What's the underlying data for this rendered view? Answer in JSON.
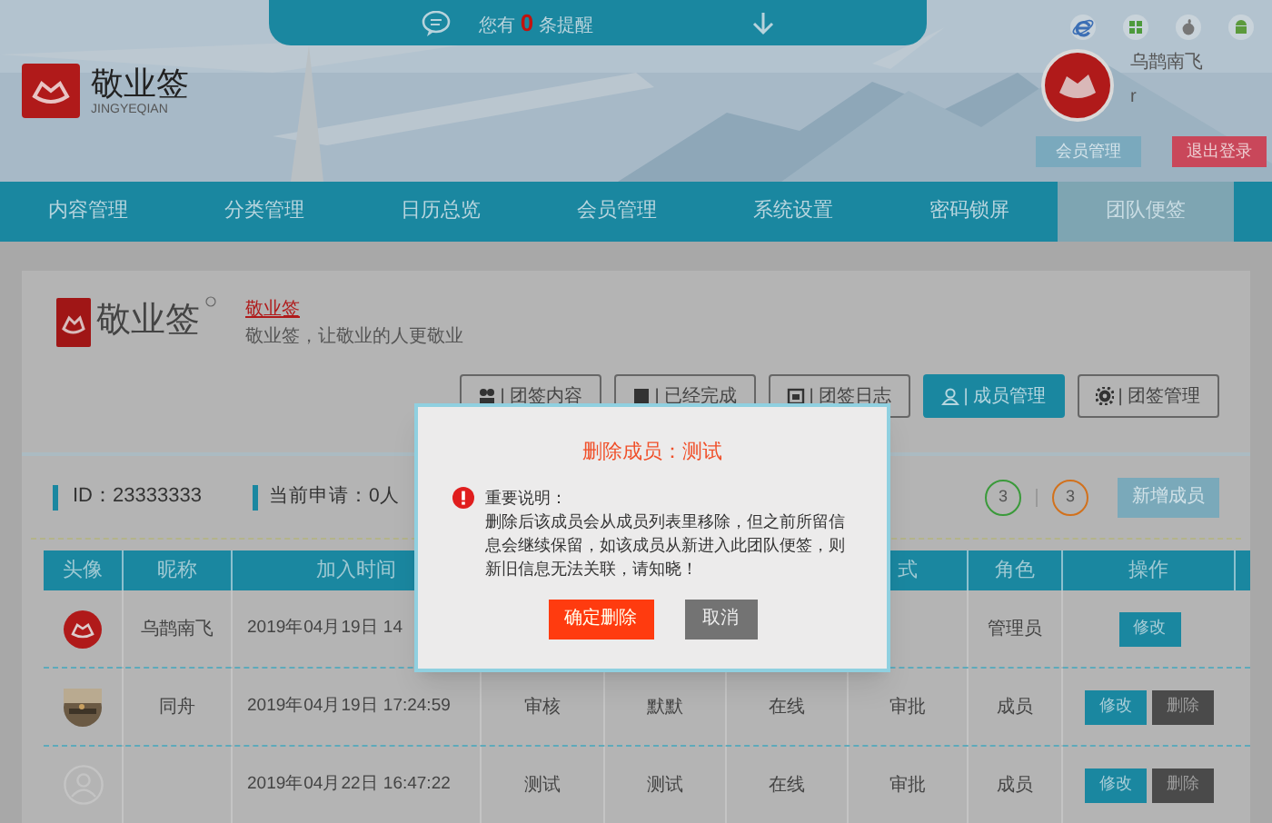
{
  "notice": {
    "prefix": "您有",
    "count": "0",
    "suffix": "条提醒"
  },
  "brand": {
    "name": "敬业签",
    "subtitle": "JINGYEQIAN"
  },
  "user": {
    "name": "乌鹊南飞",
    "account": "r",
    "buttons": [
      {
        "label": "会员管理",
        "kind": "primary"
      },
      {
        "label": "退出登录",
        "kind": "danger"
      }
    ]
  },
  "nav": [
    {
      "label": "内容管理",
      "selected": false
    },
    {
      "label": "分类管理",
      "selected": false
    },
    {
      "label": "日历总览",
      "selected": false
    },
    {
      "label": "会员管理",
      "selected": false
    },
    {
      "label": "系统设置",
      "selected": false
    },
    {
      "label": "密码锁屏",
      "selected": false
    },
    {
      "label": "团队便签",
      "selected": true
    }
  ],
  "team": {
    "logo_text": "敬业签",
    "name": "敬业签",
    "tagline": "敬业签，让敬业的人更敬业"
  },
  "tabs": [
    {
      "label": "| 团签内容",
      "kind": "people",
      "selected": false
    },
    {
      "label": "| 已经完成",
      "kind": "book",
      "selected": false
    },
    {
      "label": "| 团签日志",
      "kind": "calendar",
      "selected": false
    },
    {
      "label": "| 成员管理",
      "kind": "person",
      "selected": true
    },
    {
      "label": "| 团签管理",
      "kind": "gear",
      "selected": false
    }
  ],
  "info": {
    "id": "ID：23333333",
    "applications": "当前申请：0人",
    "counts": [
      {
        "value": "3",
        "color": "#3a9a3a"
      },
      {
        "value": "3",
        "color": "#d2711c"
      }
    ],
    "add_button": "新增成员"
  },
  "table": {
    "columns": [
      "头像",
      "昵称",
      "加入时间",
      "",
      "",
      "",
      "式",
      "角色",
      "操作"
    ],
    "rows": [
      {
        "cells": [
          {
            "kind": "logo"
          },
          "乌鹊南飞",
          "2019年04月19日 14",
          "",
          "",
          "",
          "",
          "管理员"
        ],
        "actions": [
          {
            "label": "修改",
            "kind": "edit"
          }
        ]
      },
      {
        "cells": [
          {
            "kind": "picture"
          },
          "同舟",
          "2019年04月19日 17:24:59",
          "审核",
          "默默",
          "在线",
          "审批",
          "成员"
        ],
        "actions": [
          {
            "label": "修改",
            "kind": "edit"
          },
          {
            "label": "删除",
            "kind": "delete"
          }
        ]
      },
      {
        "cells": [
          {
            "kind": "default"
          },
          "",
          "2019年04月22日 16:47:22",
          "测试",
          "测试",
          "在线",
          "审批",
          "成员"
        ],
        "actions": [
          {
            "label": "修改",
            "kind": "edit"
          },
          {
            "label": "删除",
            "kind": "delete"
          }
        ]
      }
    ]
  },
  "dialog": {
    "title": "删除成员：测试",
    "heading": "重要说明：",
    "message": "删除后该成员会从成员列表里移除，但之前所留信息会继续保留，如该成员从新进入此团队便签，则新旧信息无法关联，请知晓！",
    "buttons": [
      {
        "label": "确定删除",
        "kind": "confirm"
      },
      {
        "label": "取消",
        "kind": "cancel"
      }
    ]
  }
}
